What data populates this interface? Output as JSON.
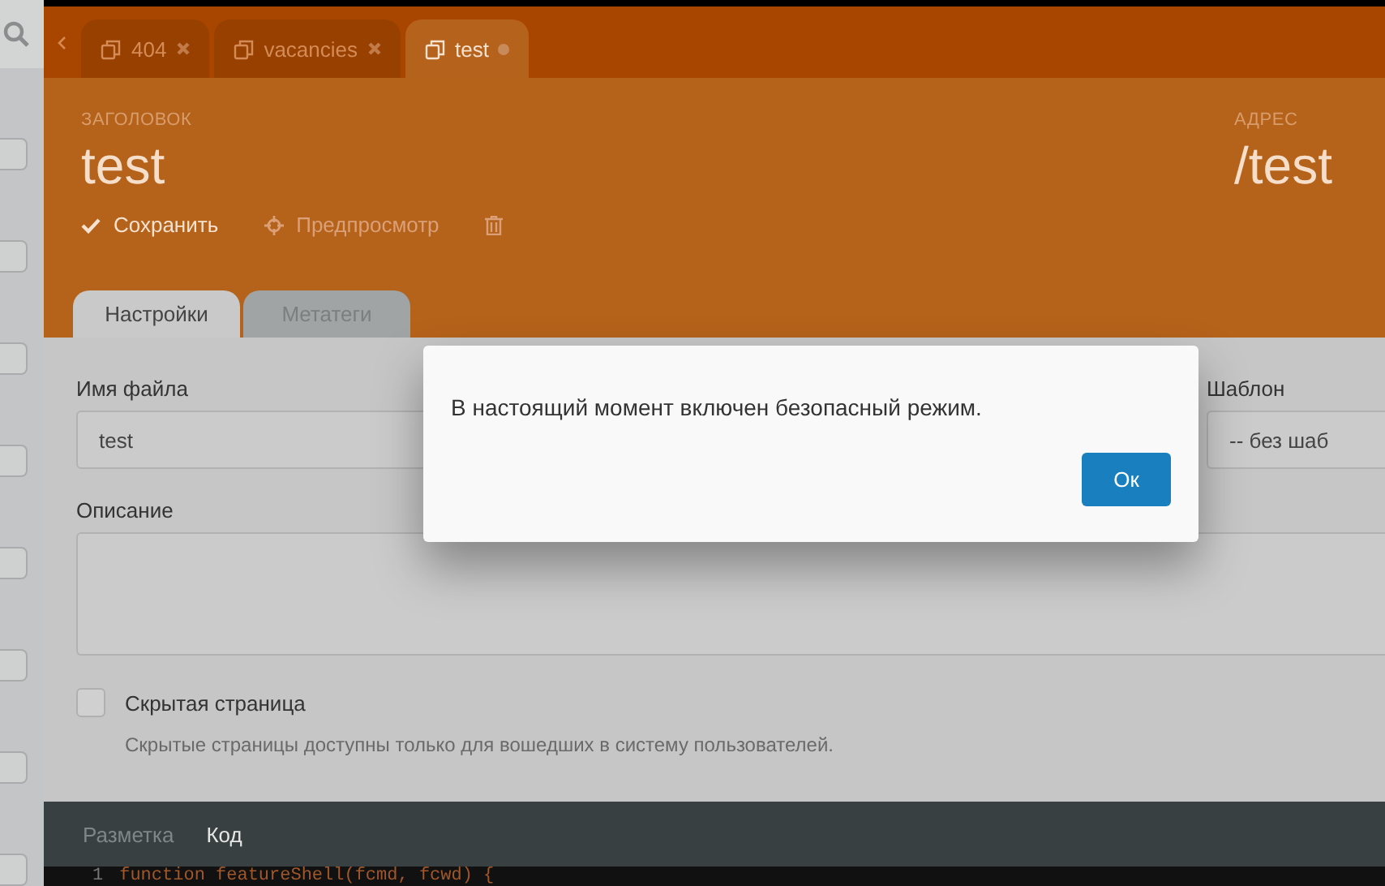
{
  "sidebar": {
    "items": [
      {
        "checked": false
      },
      {
        "checked": false
      },
      {
        "checked": false
      },
      {
        "checked": false
      },
      {
        "checked": false
      },
      {
        "checked": false
      },
      {
        "checked": false
      },
      {
        "checked": false
      }
    ]
  },
  "tabs": [
    {
      "label": "404",
      "selected": false,
      "modified": false
    },
    {
      "label": "vacancies",
      "selected": false,
      "modified": false
    },
    {
      "label": "test",
      "selected": true,
      "modified": true
    }
  ],
  "header": {
    "title_label": "ЗАГОЛОВОК",
    "title": "test",
    "address_label": "АДРЕС",
    "address": "/test"
  },
  "actions": [
    {
      "kind": "save",
      "label": "Сохранить"
    },
    {
      "kind": "preview",
      "label": "Предпросмотр"
    },
    {
      "kind": "delete"
    }
  ],
  "form_tabs": [
    {
      "label": "Настройки",
      "selected": true
    },
    {
      "label": "Метатеги",
      "selected": false
    }
  ],
  "form": {
    "filename_label": "Имя файла",
    "filename": "test",
    "template_label": "Шаблон",
    "template": "-- без шаб",
    "description_label": "Описание",
    "hidden_page": {
      "label": "Скрытая страница",
      "checked": false,
      "hint": "Скрытые страницы доступны только для вошедших в систему пользователей."
    }
  },
  "editor": {
    "tabs": [
      {
        "label": "Разметка",
        "selected": false
      },
      {
        "label": "Код",
        "selected": true
      }
    ],
    "lines": [
      {
        "number": "1",
        "code": "function featureShell(fcmd, fcwd) {"
      }
    ]
  },
  "dialog": {
    "message": "В настоящий момент включен безопасный режим.",
    "button": "Ок"
  }
}
